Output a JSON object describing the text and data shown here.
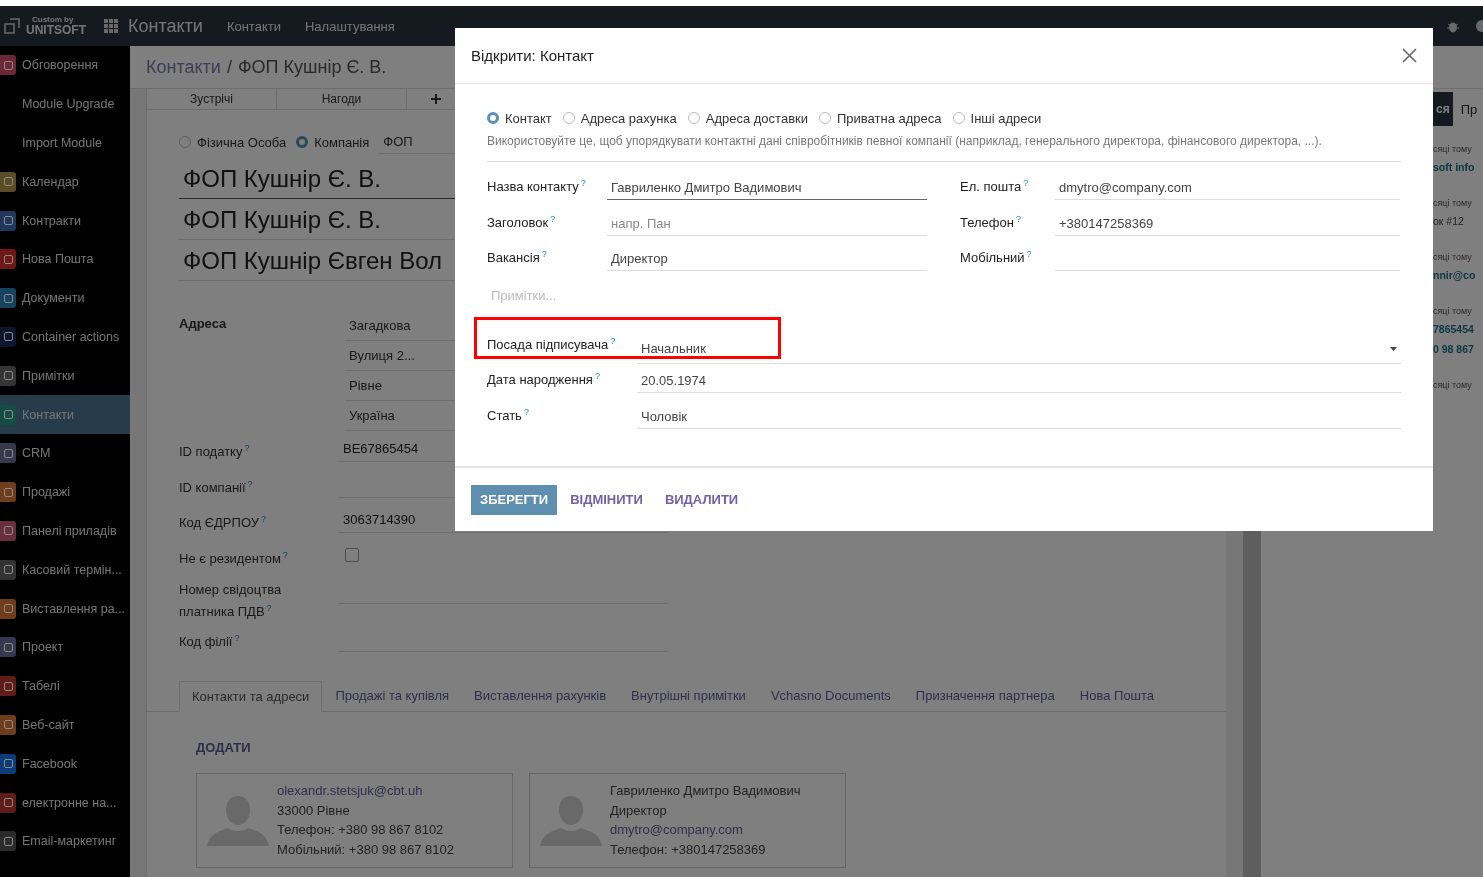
{
  "top_bar": {
    "logo_top": "Custom by",
    "logo": "UNITSOFT",
    "app_title": "Контакти",
    "menu": [
      "Контакти",
      "Налаштування"
    ]
  },
  "sidebar": {
    "items": [
      {
        "label": "Обговорення",
        "color": "#6d2837",
        "selected": false
      },
      {
        "label": "Module Upgrade",
        "selected": false
      },
      {
        "label": "Import Module",
        "selected": false
      },
      {
        "label": "Календар",
        "color": "#5a4d25",
        "selected": false
      },
      {
        "label": "Контракти",
        "color": "#1f375a",
        "selected": false
      },
      {
        "label": "Нова Пошта",
        "color": "#701815",
        "selected": false
      },
      {
        "label": "Документи",
        "color": "#154360",
        "selected": false
      },
      {
        "label": "Container actions",
        "color": "#0e162f",
        "selected": false
      },
      {
        "label": "Примітки",
        "color": "#353535",
        "selected": false
      },
      {
        "label": "Контакти",
        "color": "#154d44",
        "selected": true
      },
      {
        "label": "CRM",
        "color": "#36384e",
        "selected": false
      },
      {
        "label": "Продажі",
        "color": "#703d1c",
        "selected": false
      },
      {
        "label": "Панелі приладів",
        "color": "#6b2e3e",
        "selected": false
      },
      {
        "label": "Касовий термін...",
        "color": "#333333",
        "selected": false
      },
      {
        "label": "Виставлення ра...",
        "color": "#703d1c",
        "selected": false
      },
      {
        "label": "Проект",
        "color": "#36384e",
        "selected": false
      },
      {
        "label": "Табелі",
        "color": "#601c16",
        "selected": false
      },
      {
        "label": "Веб-сайт",
        "color": "#703d1c",
        "selected": false
      },
      {
        "label": "Facebook",
        "color": "#0c3c79",
        "selected": false
      },
      {
        "label": "електронне на...",
        "color": "#601c16",
        "selected": false
      },
      {
        "label": "Email-маркетинг",
        "color": "#2b2b2b",
        "selected": false
      }
    ]
  },
  "breadcrumb": {
    "parent": "Контакти",
    "separator": "/",
    "current": "ФОП Кушнір Є. В."
  },
  "smart_buttons": [
    "Зустрічі",
    "Нагоди"
  ],
  "company_type": [
    {
      "label": "Фізична Особа",
      "selected": false
    },
    {
      "label": "Компанія",
      "selected": true
    }
  ],
  "company_field": "ФОП",
  "names": [
    "ФОП Кушнір Є. В.",
    "ФОП Кушнір Є. В.",
    "ФОП Кушнір Євген Вол"
  ],
  "address": {
    "label": "Адреса",
    "lines": [
      "Загадкова",
      "Вулиця 2...",
      "Рівне",
      "Україна"
    ]
  },
  "fields": [
    {
      "label": "ID податку",
      "help": "?",
      "kind": "text",
      "value": "BE67865454"
    },
    {
      "label": "ID компанії",
      "help": "?",
      "kind": "text"
    },
    {
      "label": "Код ЄДРПОУ",
      "help": "?",
      "kind": "text",
      "value": "3063714390"
    },
    {
      "label": "Не є резидентом",
      "help": "?",
      "kind": "checkbox",
      "checked": false
    },
    {
      "label": "Номер свідоцтва платника ПДВ",
      "help": "?",
      "kind": "text"
    },
    {
      "label": "Код філії",
      "help": "?",
      "kind": "text"
    }
  ],
  "tabs": [
    {
      "label": "Контакти та адреси",
      "selected": true
    },
    {
      "label": "Продажі та купівля",
      "selected": false
    },
    {
      "label": "Виставлення рахунків",
      "selected": false
    },
    {
      "label": "Внутрішні примітки",
      "selected": false
    },
    {
      "label": "Vchasno Documents",
      "selected": false
    },
    {
      "label": "Призначення партнера",
      "selected": false
    },
    {
      "label": "Нова Пошта",
      "selected": false
    }
  ],
  "add_button": "ДОДАТИ",
  "contact_cards": [
    {
      "lines": [
        {
          "text": "olexandr.stetsjuk@cbt.uh",
          "kind": "link"
        },
        {
          "text": "33000 Рівне",
          "kind": "text"
        },
        {
          "text": "Телефон: +380 98 867 8102",
          "kind": "text"
        },
        {
          "text": "Мобільний: +380 98 867 8102",
          "kind": "text"
        }
      ]
    },
    {
      "lines": [
        {
          "text": "Гавриленко Дмитро Вадимович",
          "kind": "text"
        },
        {
          "text": "Директор",
          "kind": "text"
        },
        {
          "text": "dmytro@company.com",
          "kind": "link"
        },
        {
          "text": "Телефон: +380147258369",
          "kind": "text"
        }
      ]
    }
  ],
  "chatter": {
    "button": "ся",
    "tab": "Пр",
    "messages": [
      {
        "time": "сяці тому",
        "lines": [
          {
            "text": "soft info",
            "kind": "link"
          }
        ]
      },
      {
        "time": "сяці тому",
        "lines": [
          {
            "text": "ок #12",
            "kind": "text"
          }
        ]
      },
      {
        "time": "сяці тому",
        "lines": [
          {
            "text": "nnir@co",
            "kind": "link"
          }
        ]
      },
      {
        "time": "сяці тому",
        "lines": [
          {
            "text": "7865454",
            "kind": "link"
          },
          {
            "text": "0 98 867",
            "kind": "link"
          }
        ]
      },
      {
        "time": "сяці тому"
      }
    ]
  },
  "dialog": {
    "title": "Відкрити: Контакт",
    "types": [
      {
        "label": "Контакт",
        "selected": true
      },
      {
        "label": "Адреса рахунка",
        "selected": false
      },
      {
        "label": "Адреса доставки",
        "selected": false
      },
      {
        "label": "Приватна адреса",
        "selected": false
      },
      {
        "label": "Інші адреси",
        "selected": false
      }
    ],
    "hint": "Використовуйте це, щоб упорядкувати контактні дані співробітників певної компанії (наприклад, генерального директора, фінансового директора, ...).",
    "left_fields": [
      {
        "label": "Назва контакту",
        "help": "?",
        "value": "Гавриленко Дмитро Вадимович",
        "required": true
      },
      {
        "label": "Заголовок",
        "help": "?",
        "placeholder": "напр. Пан",
        "required": false
      },
      {
        "label": "Вакансія",
        "help": "?",
        "value": "Директор",
        "required": false
      }
    ],
    "right_fields": [
      {
        "label": "Ел. пошта",
        "help": "?",
        "value": "dmytro@company.com"
      },
      {
        "label": "Телефон",
        "help": "?",
        "value": "+380147258369"
      },
      {
        "label": "Мобільний",
        "help": "?"
      }
    ],
    "notes": {
      "placeholder": "Примітки..."
    },
    "wide_fields": [
      {
        "label": "Посада підписувача",
        "help": "?",
        "value": "Начальник",
        "kind": "select",
        "highlighted": true
      },
      {
        "label": "Дата народження",
        "help": "?",
        "value": "20.05.1974",
        "kind": "text",
        "highlighted": false
      },
      {
        "label": "Стать",
        "help": "?",
        "value": "Чоловік",
        "kind": "text",
        "highlighted": false
      }
    ],
    "buttons": [
      {
        "label": "ЗБЕРЕГТИ",
        "kind": "primary"
      },
      {
        "label": "ВІДМІНИТИ",
        "kind": "link"
      },
      {
        "label": "ВИДАЛИТИ",
        "kind": "link"
      }
    ]
  }
}
